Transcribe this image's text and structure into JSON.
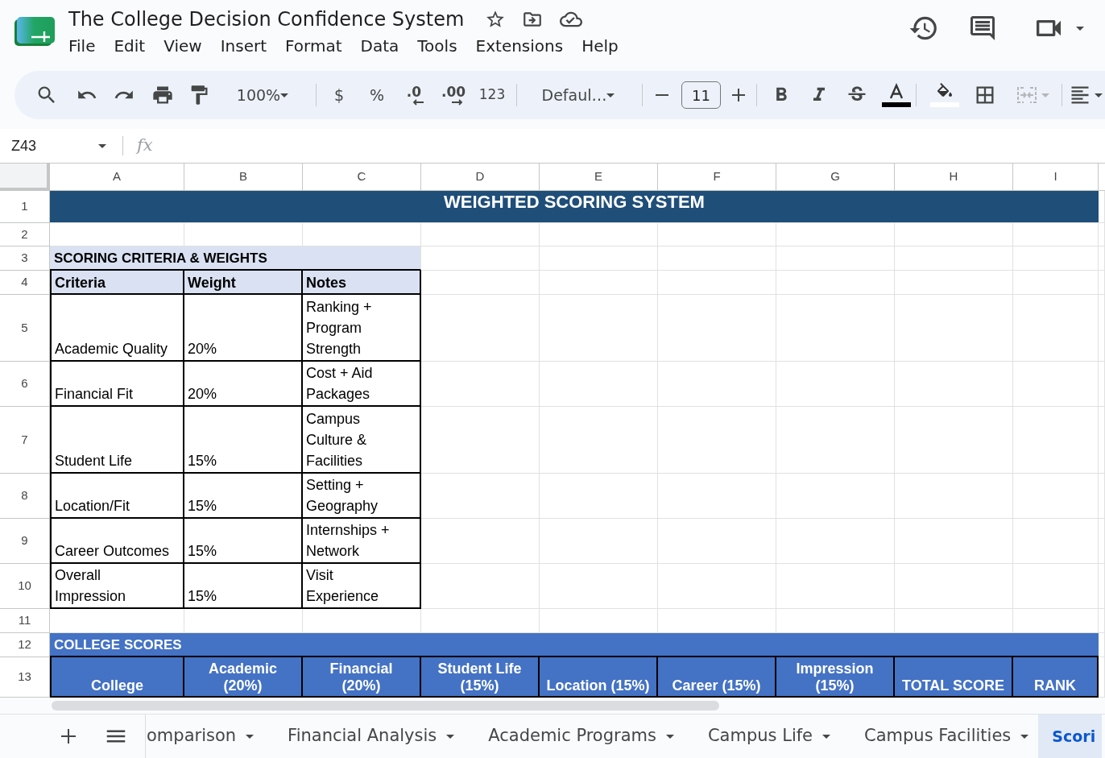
{
  "document": {
    "title": "The College Decision Confidence System",
    "menu": [
      "File",
      "Edit",
      "View",
      "Insert",
      "Format",
      "Data",
      "Tools",
      "Extensions",
      "Help"
    ]
  },
  "toolbar": {
    "zoom": "100%",
    "currency_format": "$",
    "percent_format": "%",
    "decrease_decimal": ".0",
    "increase_decimal": ".00",
    "more_formats": "123",
    "font": "Defaul…",
    "font_size": "11",
    "merge_cells": {
      "disabled": true
    }
  },
  "formula_bar": {
    "cell_reference": "Z43",
    "function_label": "fx"
  },
  "sheet": {
    "column_headers": [
      "A",
      "B",
      "C",
      "D",
      "E",
      "F",
      "G",
      "H",
      "I"
    ],
    "row_headers": [
      "1",
      "2",
      "3",
      "4",
      "5",
      "6",
      "7",
      "8",
      "9",
      "10",
      "11",
      "12",
      "13"
    ],
    "title_banner": "WEIGHTED SCORING SYSTEM",
    "criteria_section": {
      "title": "SCORING CRITERIA & WEIGHTS",
      "columns": [
        "Criteria",
        "Weight",
        "Notes"
      ],
      "rows": [
        {
          "criteria": "Academic Quality",
          "weight": "20%",
          "notes": "Ranking + Program Strength"
        },
        {
          "criteria": "Financial Fit",
          "weight": "20%",
          "notes": "Cost + Aid Packages"
        },
        {
          "criteria": "Student Life",
          "weight": "15%",
          "notes": "Campus Culture & Facilities"
        },
        {
          "criteria": "Location/Fit",
          "weight": "15%",
          "notes": "Setting + Geography"
        },
        {
          "criteria": "Career Outcomes",
          "weight": "15%",
          "notes": "Internships + Network"
        },
        {
          "criteria": "Overall Impression",
          "weight": "15%",
          "notes": "Visit Experience"
        }
      ]
    },
    "scores_section": {
      "title": "COLLEGE SCORES",
      "columns": [
        "College",
        "Academic (20%)",
        "Financial (20%)",
        "Student Life (15%)",
        "Location (15%)",
        "Career (15%)",
        "Impression (15%)",
        "TOTAL SCORE",
        "RANK"
      ]
    }
  },
  "sheet_tabs": [
    {
      "label": "omparison",
      "selected": false
    },
    {
      "label": "Financial Analysis",
      "selected": false
    },
    {
      "label": "Academic Programs",
      "selected": false
    },
    {
      "label": "Campus Life",
      "selected": false
    },
    {
      "label": "Campus Facilities",
      "selected": false
    },
    {
      "label": "Scori",
      "selected": true
    }
  ]
}
